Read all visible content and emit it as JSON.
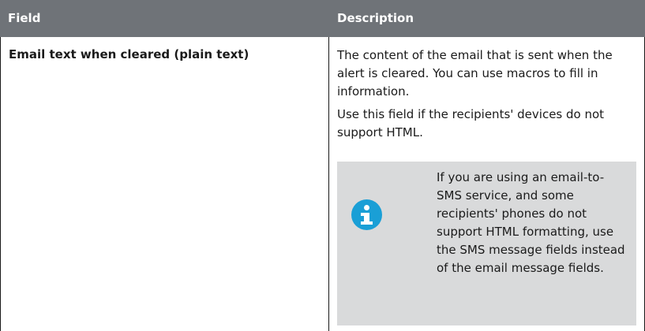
{
  "table": {
    "headers": {
      "field": "Field",
      "description": "Description"
    },
    "row": {
      "field": "Email text when cleared (plain text)",
      "description_paragraphs": [
        "The content of the email that is sent when the alert is cleared. You can use macros to fill in information.",
        "Use this field if the recipients' devices do not support HTML."
      ],
      "note": {
        "icon": "info-icon",
        "text": "If you are using an email-to-SMS service, and some recipients' phones do not support HTML formatting, use the SMS message fields instead of the email message fields."
      }
    }
  },
  "colors": {
    "header_bg": "#6f7378",
    "note_bg": "#d9dadb",
    "info_icon": "#1a9fd6"
  }
}
